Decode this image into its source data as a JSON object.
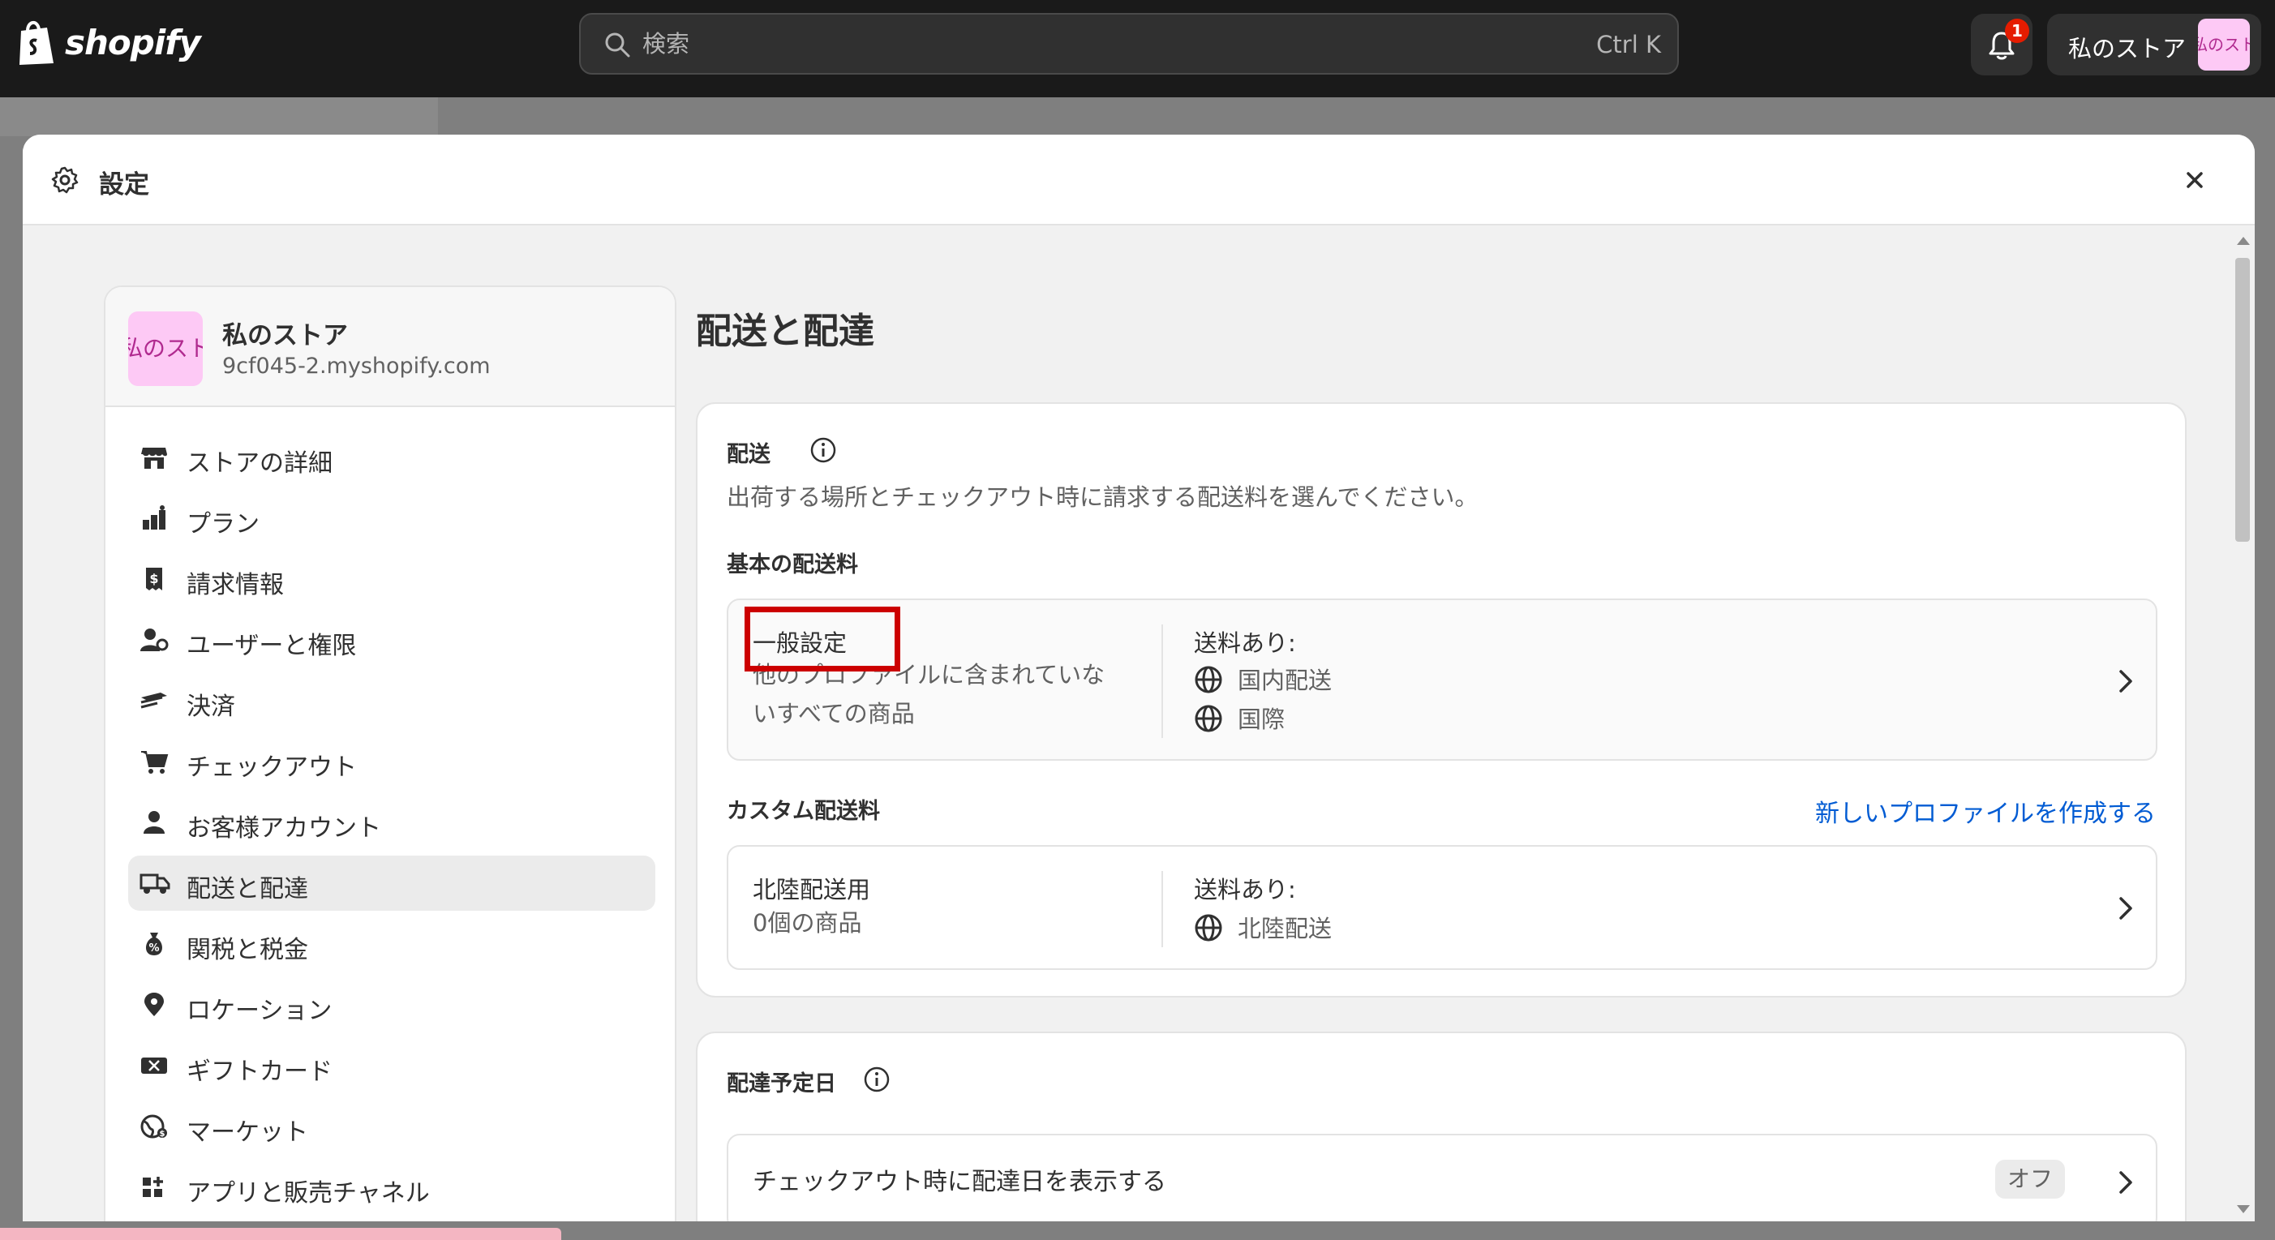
{
  "topbar": {
    "logo_text": "shopify",
    "search_placeholder": "検索",
    "search_shortcut": "Ctrl K",
    "notification_count": "1",
    "store_name": "私のストア",
    "store_avatar_text": "私のストア"
  },
  "modal": {
    "title": "設定"
  },
  "sidebar": {
    "store_name": "私のストア",
    "store_url": "9cf045-2.myshopify.com",
    "avatar_text": "私のストア",
    "items": [
      {
        "label": "ストアの詳細",
        "icon": "store-icon"
      },
      {
        "label": "プラン",
        "icon": "plan-icon"
      },
      {
        "label": "請求情報",
        "icon": "billing-icon"
      },
      {
        "label": "ユーザーと権限",
        "icon": "users-icon"
      },
      {
        "label": "決済",
        "icon": "payments-icon"
      },
      {
        "label": "チェックアウト",
        "icon": "cart-icon"
      },
      {
        "label": "お客様アカウント",
        "icon": "person-icon"
      },
      {
        "label": "配送と配達",
        "icon": "truck-icon",
        "active": true
      },
      {
        "label": "関税と税金",
        "icon": "tax-icon"
      },
      {
        "label": "ロケーション",
        "icon": "location-icon"
      },
      {
        "label": "ギフトカード",
        "icon": "gift-card-icon"
      },
      {
        "label": "マーケット",
        "icon": "globe-icon"
      },
      {
        "label": "アプリと販売チャネル",
        "icon": "apps-icon"
      }
    ]
  },
  "main": {
    "page_title": "配送と配達",
    "shipping": {
      "title": "配送",
      "description": "出荷する場所とチェックアウト時に請求する配送料を選んでください。",
      "general_rates_title": "基本の配送料",
      "general_profile": {
        "name": "一般設定",
        "subtitle_line1": "他のプロファイルに含まれていな",
        "subtitle_line2": "いすべての商品",
        "rates_title": "送料あり:",
        "rates": [
          "国内配送",
          "国際"
        ]
      },
      "custom_rates_title": "カスタム配送料",
      "create_profile_link": "新しいプロファイルを作成する",
      "custom_profile": {
        "name": "北陸配送用",
        "subtitle": "0個の商品",
        "rates_title": "送料あり:",
        "rates": [
          "北陸配送"
        ]
      }
    },
    "delivery_dates": {
      "title": "配達予定日",
      "row_label": "チェックアウト時に配達日を表示する",
      "status": "オフ"
    }
  },
  "colors": {
    "topbar_bg": "#1a1a1a",
    "link": "#005bd3",
    "highlight": "#cc0000",
    "avatar_bg": "#fdc9f5"
  }
}
